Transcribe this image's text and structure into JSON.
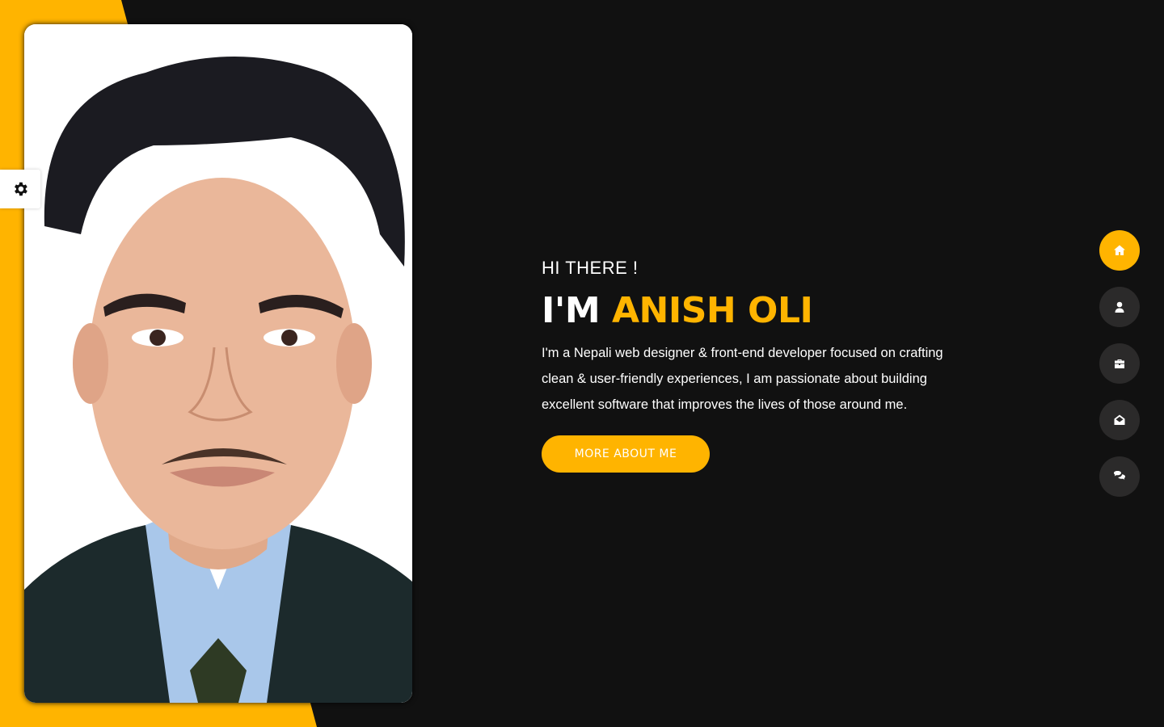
{
  "hero": {
    "greeting": "HI THERE !",
    "name_prefix": "I'M ",
    "name": "ANISH OLI",
    "bio": "I'm a Nepali web designer & front-end developer focused on crafting clean & user-friendly experiences, I am passionate about building excellent software that improves the lives of those around me.",
    "cta_label": "MORE ABOUT ME"
  },
  "nav": {
    "items": [
      {
        "icon": "home-icon",
        "active": true
      },
      {
        "icon": "user-icon",
        "active": false
      },
      {
        "icon": "briefcase-icon",
        "active": false
      },
      {
        "icon": "envelope-open-icon",
        "active": false
      },
      {
        "icon": "comments-icon",
        "active": false
      }
    ]
  },
  "settings": {
    "icon": "gear-icon"
  },
  "colors": {
    "accent": "#ffb400",
    "background": "#111111",
    "nav_inactive": "#2b2a2a",
    "text": "#ffffff"
  }
}
